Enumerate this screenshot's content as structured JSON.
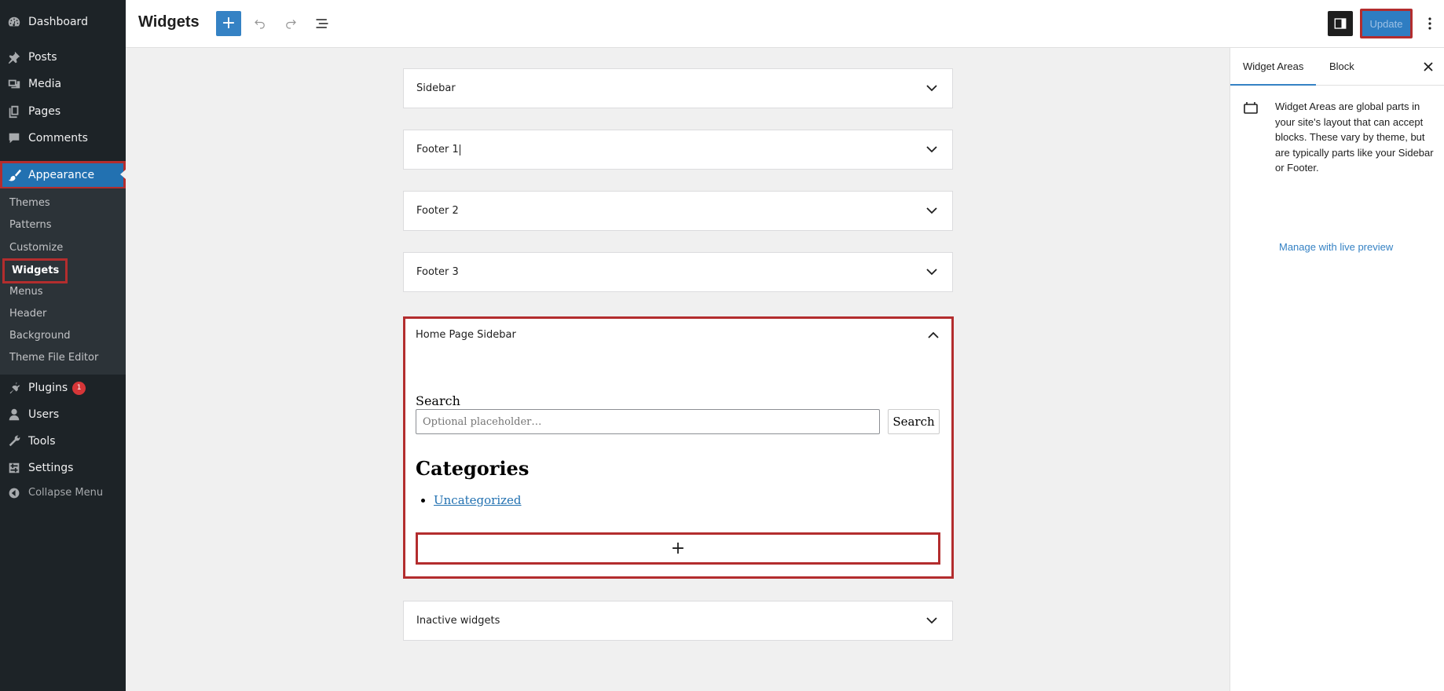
{
  "admin_menu": {
    "dashboard": "Dashboard",
    "posts": "Posts",
    "media": "Media",
    "pages": "Pages",
    "comments": "Comments",
    "appearance": "Appearance",
    "submenu": [
      "Themes",
      "Patterns",
      "Customize",
      "Widgets",
      "Menus",
      "Header",
      "Background",
      "Theme File Editor"
    ],
    "plugins": "Plugins",
    "plugins_badge": "1",
    "users": "Users",
    "tools": "Tools",
    "settings": "Settings",
    "collapse": "Collapse Menu"
  },
  "header": {
    "title": "Widgets",
    "update_label": "Update"
  },
  "widget_areas": [
    {
      "title": "Sidebar"
    },
    {
      "title": "Footer 1"
    },
    {
      "title": "Footer 2"
    },
    {
      "title": "Footer 3"
    },
    {
      "title": "Home Page Sidebar"
    },
    {
      "title": "Inactive widgets"
    }
  ],
  "home_sidebar": {
    "search_label": "Search",
    "search_placeholder": "Optional placeholder…",
    "search_button": "Search",
    "categories_heading": "Categories",
    "categories": [
      "Uncategorized"
    ],
    "appender_symbol": "+"
  },
  "settings_panel": {
    "tab_widget_areas": "Widget Areas",
    "tab_block": "Block",
    "description": "Widget Areas are global parts in your site's layout that can accept blocks. These vary by theme, but are typically parts like your Sidebar or Footer.",
    "link": "Manage with live preview"
  },
  "colors": {
    "admin_bg": "#1d2327",
    "accent": "#2271b1",
    "highlight_border": "#b32d2e"
  }
}
